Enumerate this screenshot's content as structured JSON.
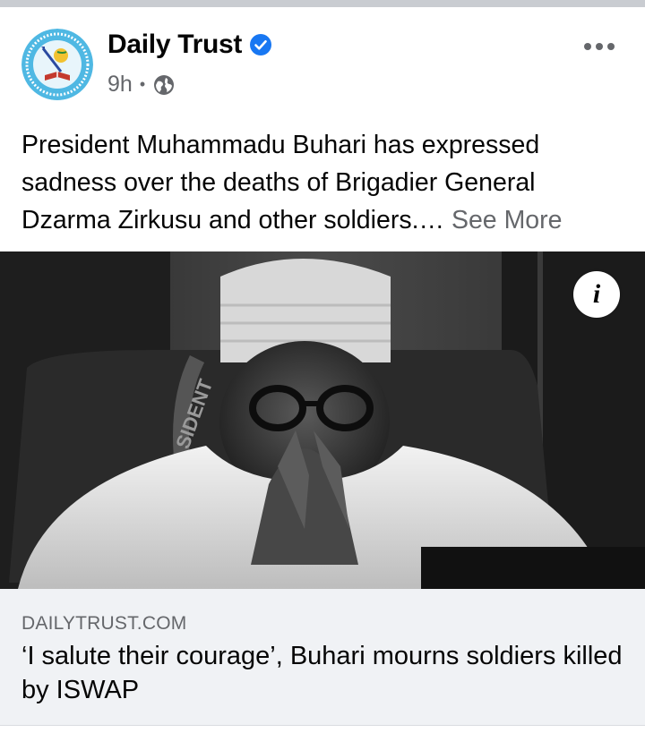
{
  "post": {
    "page_name": "Daily Trust",
    "verified_icon": "verified-badge-icon",
    "time": "9h",
    "separator": "•",
    "audience_icon": "globe-icon",
    "text": "President Muhammadu Buhari has expressed sadness over the deaths of Brigadier General Dzarma Zirkusu and other soldiers.…",
    "see_more": "See More"
  },
  "media": {
    "info_label": "i",
    "photo_text": "SIDENT"
  },
  "link": {
    "domain": "DAILYTRUST.COM",
    "title": "‘I salute their courage’, Buhari mourns soldiers killed by ISWAP"
  },
  "colors": {
    "brand_blue": "#1877f2",
    "secondary_text": "#65676b",
    "link_bg": "#f0f2f5"
  }
}
